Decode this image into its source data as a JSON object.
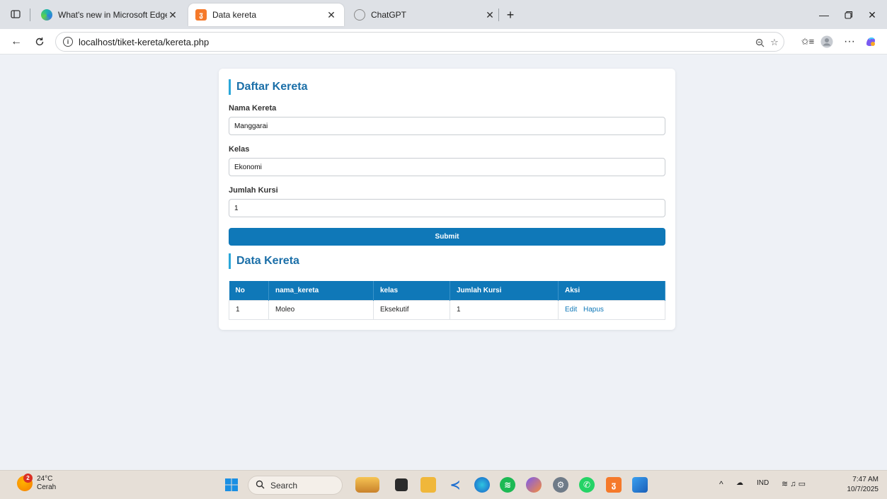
{
  "browser": {
    "tabs": [
      {
        "title": "What's new in Microsoft Edge"
      },
      {
        "title": "Data kereta"
      },
      {
        "title": "ChatGPT"
      }
    ],
    "url": "localhost/tiket-kereta/kereta.php"
  },
  "form": {
    "title": "Daftar Kereta",
    "fields": [
      {
        "label": "Nama Kereta",
        "value": "Manggarai"
      },
      {
        "label": "Kelas",
        "value": "Ekonomi"
      },
      {
        "label": "Jumlah Kursi",
        "value": "1"
      }
    ],
    "submit_label": "Submit"
  },
  "table": {
    "title": "Data Kereta",
    "headers": [
      "No",
      "nama_kereta",
      "kelas",
      "Jumlah Kursi",
      "Aksi"
    ],
    "rows": [
      {
        "no": "1",
        "nama": "Moleo",
        "kelas": "Eksekutif",
        "kursi": "1",
        "edit": "Edit",
        "hapus": "Hapus"
      }
    ]
  },
  "taskbar": {
    "weather_temp": "24°C",
    "weather_desc": "Cerah",
    "weather_badge": "2",
    "search_placeholder": "Search",
    "lang": "IND",
    "time": "7:47 AM",
    "date": "10/7/2025"
  },
  "colors": {
    "accent": "#0f78b8",
    "title_bar": "#2ba7d9"
  }
}
